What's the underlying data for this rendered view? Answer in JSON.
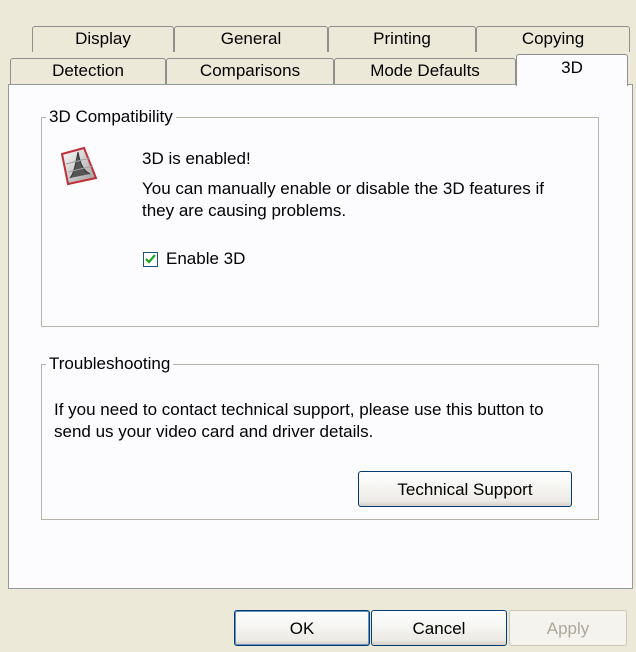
{
  "tabs_back": [
    "Display",
    "General",
    "Printing",
    "Copying"
  ],
  "tabs_front": [
    "Detection",
    "Comparisons",
    "Mode Defaults",
    "3D"
  ],
  "compat": {
    "legend": "3D Compatibility",
    "status": "3D is enabled!",
    "description_line1": "You can manually enable or disable the 3D features if",
    "description_line2": "they are causing problems.",
    "checkbox_label": "Enable 3D",
    "checkbox_checked": true
  },
  "troubleshooting": {
    "legend": "Troubleshooting",
    "description_line1": "If you need to contact technical support, please use this button to",
    "description_line2": "send us your video card and driver details.",
    "button_label": "Technical Support"
  },
  "footer": {
    "ok_label": "OK",
    "cancel_label": "Cancel",
    "apply_label": "Apply"
  },
  "colors": {
    "dialog_bg": "#ece9d8",
    "panel_bg": "#fcfcfe",
    "check_color": "#21a121"
  }
}
